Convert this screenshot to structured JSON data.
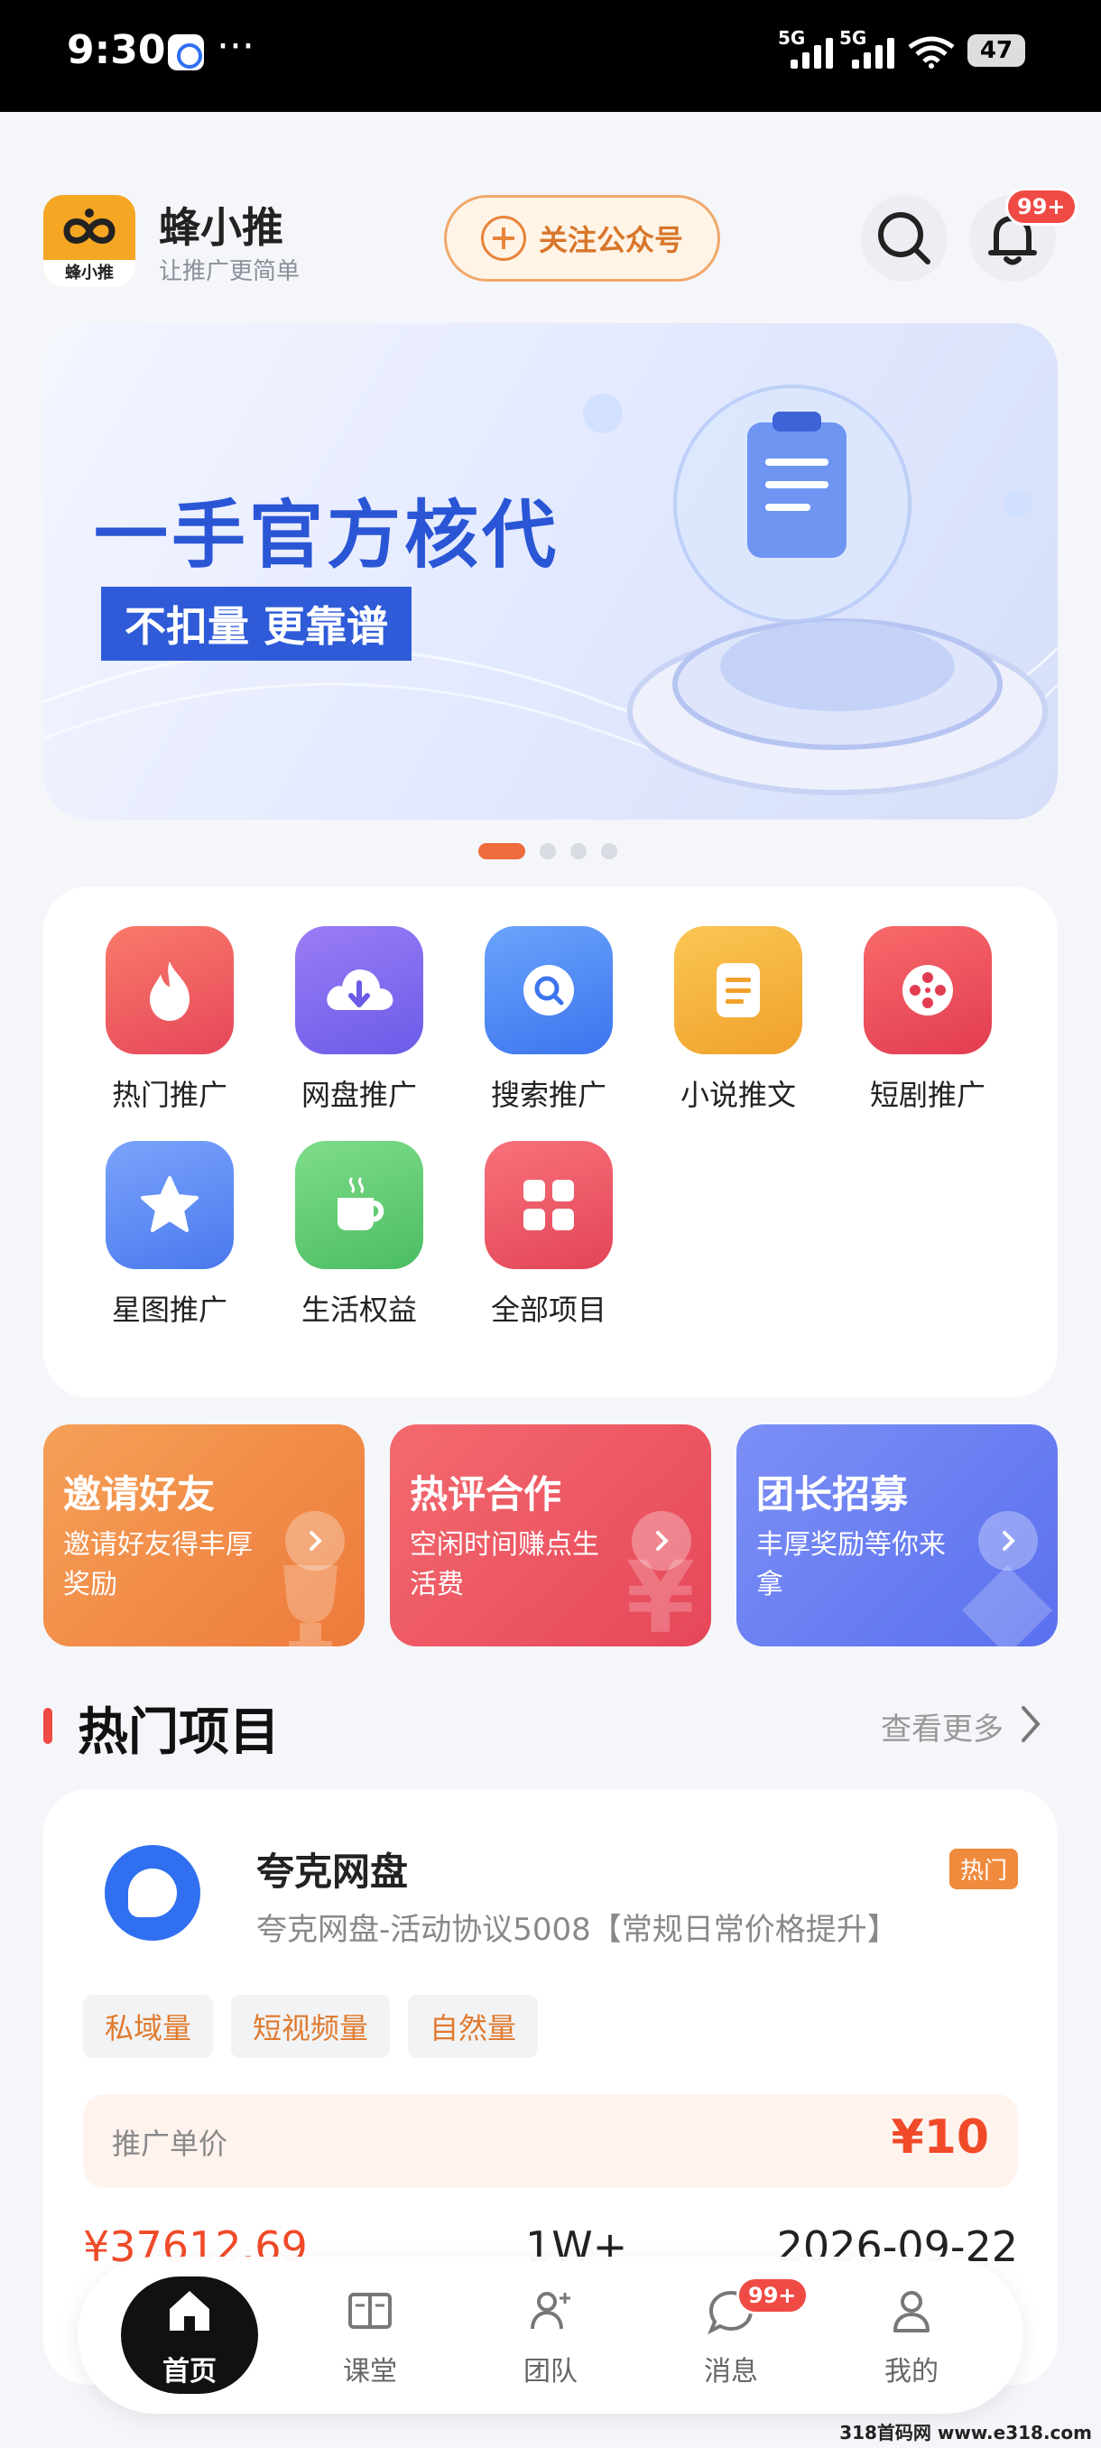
{
  "status_bar": {
    "time": "9:30",
    "more": "···",
    "signal1": "5G",
    "signal2": "5G",
    "battery": "47"
  },
  "header": {
    "app_name": "蜂小推",
    "app_subtitle": "让推广更简单",
    "logo_text": "蜂小推",
    "follow_label": "关注公众号",
    "notification_badge": "99+"
  },
  "banner": {
    "title": "一手官方核代",
    "tagline": "不扣量 更靠谱",
    "total_slides": 4,
    "active_slide": 1
  },
  "grid": {
    "items": [
      {
        "label": "热门推广",
        "icon": "fire-icon",
        "color": "#ef5b5b"
      },
      {
        "label": "网盘推广",
        "icon": "cloud-download-icon",
        "color": "#7b6cf0"
      },
      {
        "label": "搜索推广",
        "icon": "search-icon",
        "color": "#4f8ef7"
      },
      {
        "label": "小说推文",
        "icon": "document-icon",
        "color": "#f5b33d"
      },
      {
        "label": "短剧推广",
        "icon": "film-reel-icon",
        "color": "#ef4f5a"
      },
      {
        "label": "星图推广",
        "icon": "star-icon",
        "color": "#5a8cf7"
      },
      {
        "label": "生活权益",
        "icon": "cup-icon",
        "color": "#5dca72"
      },
      {
        "label": "全部项目",
        "icon": "grid-icon",
        "color": "#ef5662"
      }
    ]
  },
  "promos": [
    {
      "title": "邀请好友",
      "desc": "邀请好友得丰厚奖励",
      "color": "#f08a3c"
    },
    {
      "title": "热评合作",
      "desc": "空闲时间赚点生活费",
      "color": "#ef5560"
    },
    {
      "title": "团长招募",
      "desc": "丰厚奖励等你来拿",
      "color": "#6a80f2"
    }
  ],
  "section": {
    "title": "热门项目",
    "more": "查看更多"
  },
  "project": {
    "name": "夸克网盘",
    "desc": "夸克网盘-活动协议5008【常规日常价格提升】",
    "hot": "热门",
    "tags": [
      "私域量",
      "短视频量",
      "自然量"
    ],
    "price_label": "推广单价",
    "price": "¥10",
    "stats": [
      "¥37612.69",
      "1W+",
      "2026-09-22"
    ]
  },
  "nav": {
    "items": [
      {
        "label": "首页",
        "active": true
      },
      {
        "label": "课堂"
      },
      {
        "label": "团队"
      },
      {
        "label": "消息",
        "badge": "99+"
      },
      {
        "label": "我的"
      }
    ]
  },
  "watermark": "318首码网 www.e318.com"
}
